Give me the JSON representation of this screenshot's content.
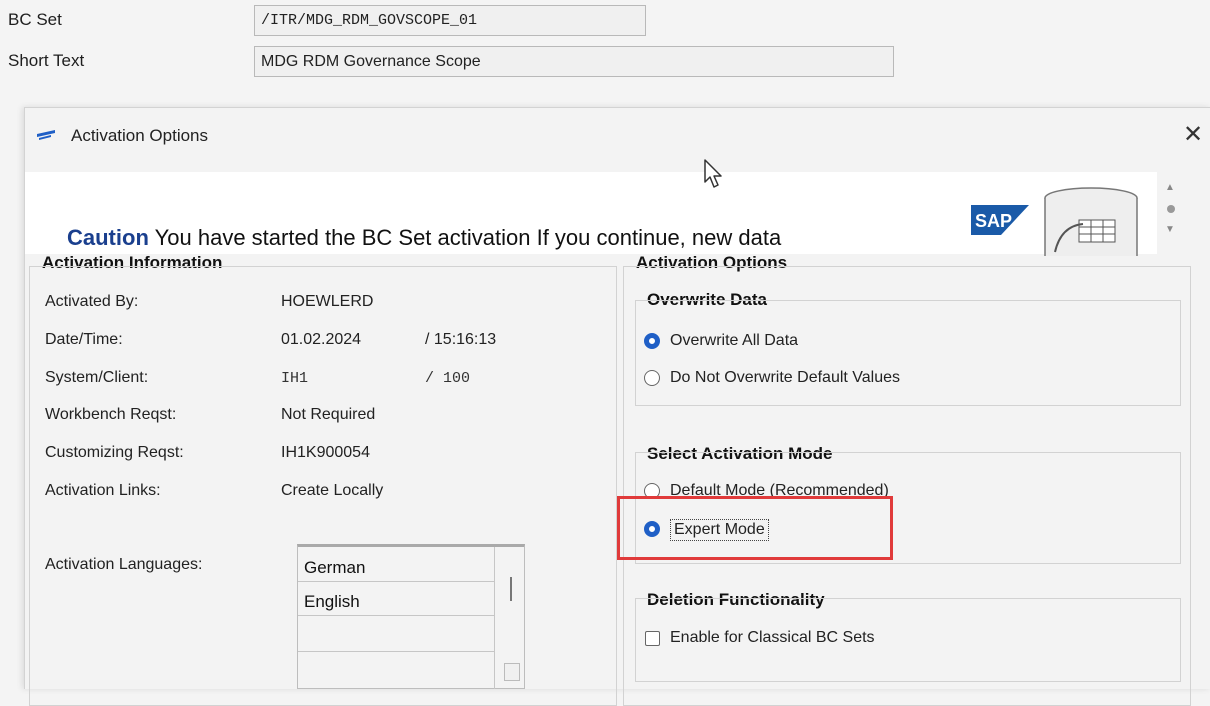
{
  "header": {
    "bc_set_label": "BC Set",
    "bc_set_value": "/ITR/MDG_RDM_GOVSCOPE_01",
    "short_text_label": "Short Text",
    "short_text_value": "MDG RDM Governance Scope"
  },
  "dialog": {
    "title": "Activation Options",
    "caution_bold": "Caution",
    "caution_text": " You have started the BC Set activation If you continue, new data",
    "logo_text": "SAP"
  },
  "activation_info": {
    "title": "Activation Information",
    "rows": [
      {
        "label": "Activated By:",
        "value": "HOEWLERD",
        "extra": ""
      },
      {
        "label": "Date/Time:",
        "value": "01.02.2024",
        "extra": "/ 15:16:13"
      },
      {
        "label": "System/Client:",
        "value": "IH1",
        "extra": "/ 100"
      },
      {
        "label": "Workbench Reqst:",
        "value": "Not Required",
        "extra": ""
      },
      {
        "label": "Customizing Reqst:",
        "value": "IH1K900054",
        "extra": ""
      },
      {
        "label": "Activation Links:",
        "value": "Create Locally",
        "extra": ""
      }
    ],
    "languages_label": "Activation Languages:",
    "languages": [
      "German",
      "English"
    ]
  },
  "activation_options": {
    "title": "Activation Options",
    "overwrite": {
      "title": "Overwrite Data",
      "options": [
        {
          "label": "Overwrite All Data",
          "selected": true
        },
        {
          "label": "Do Not Overwrite Default Values",
          "selected": false
        }
      ]
    },
    "mode": {
      "title": "Select Activation Mode",
      "options": [
        {
          "label": "Default Mode (Recommended)",
          "selected": false
        },
        {
          "label": "Expert Mode",
          "selected": true
        }
      ],
      "highlight_color": "#e03a3a"
    },
    "deletion": {
      "title": "Deletion Functionality",
      "checkbox_label": "Enable for Classical BC Sets",
      "checked": false
    }
  },
  "colors": {
    "accent": "#1f5fc6",
    "caution_blue": "#1a3f8e",
    "sap_blue": "#1a5aa8"
  }
}
